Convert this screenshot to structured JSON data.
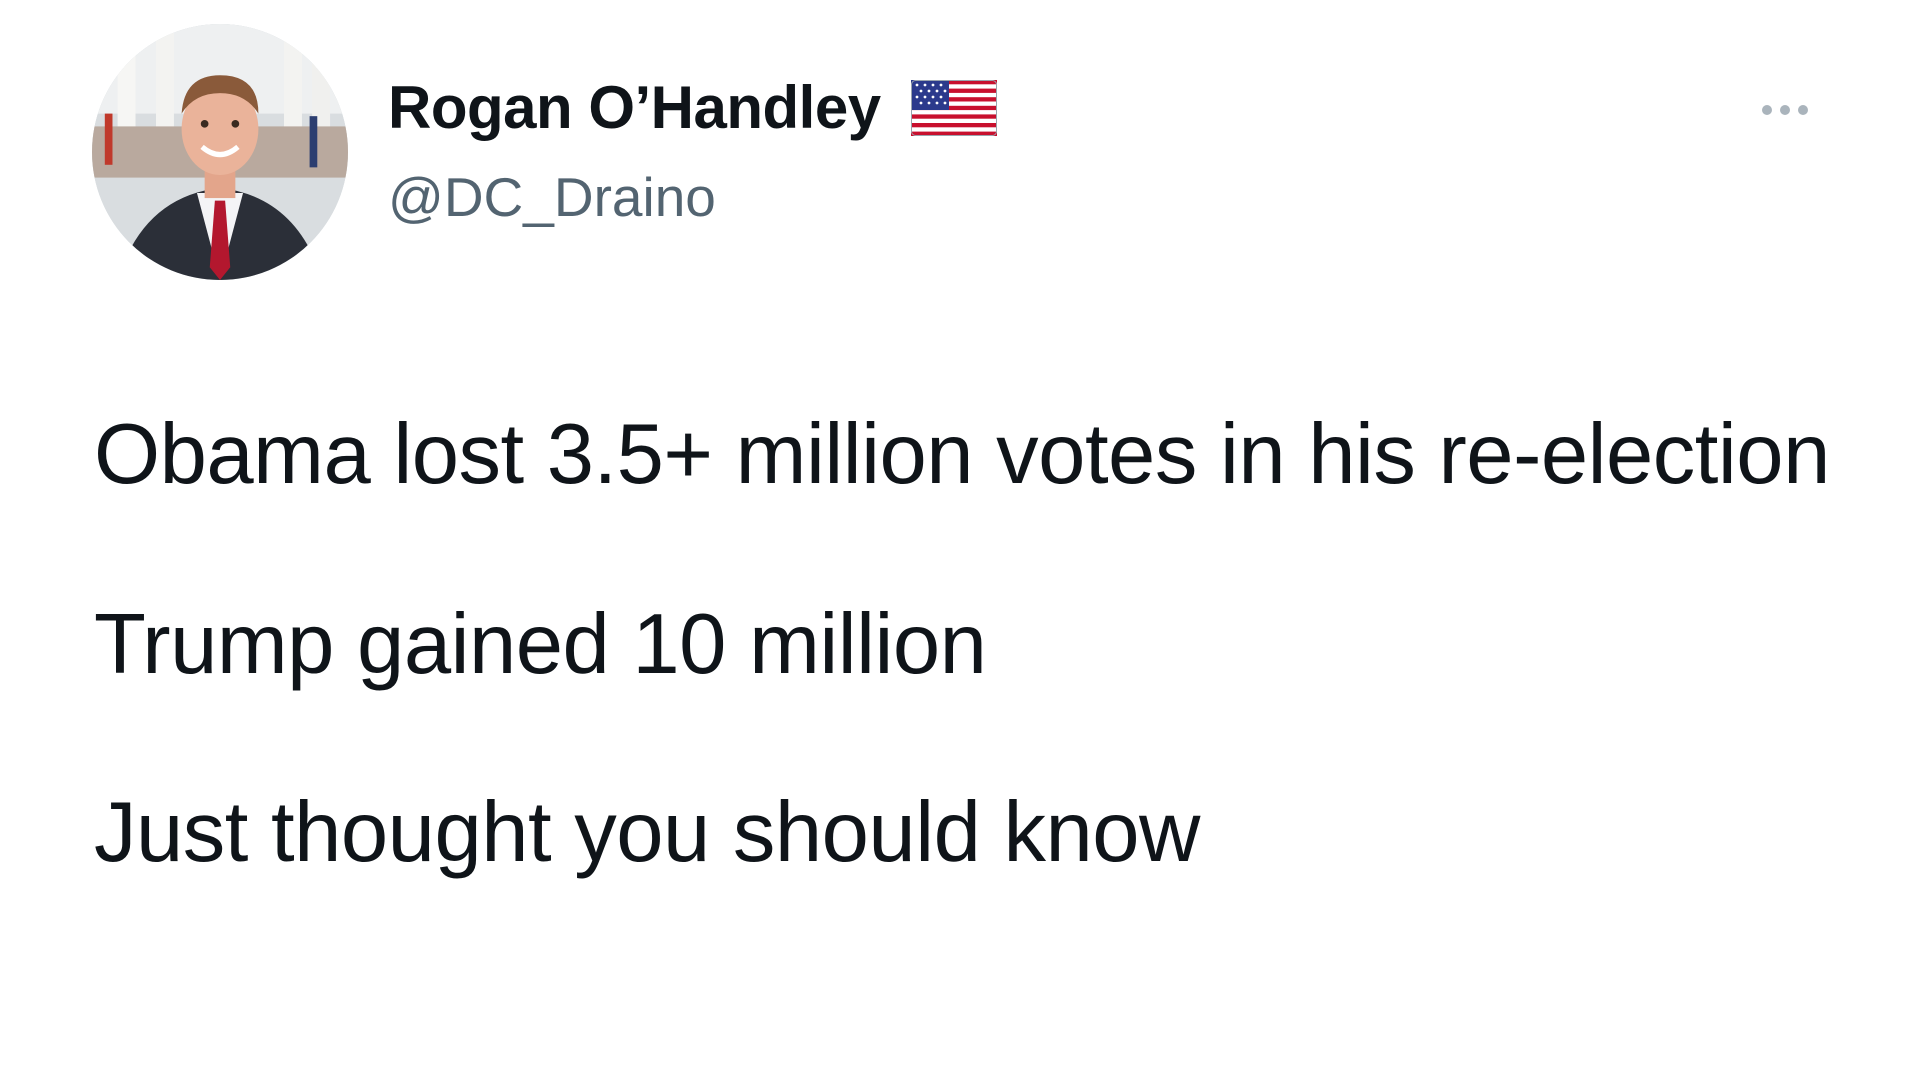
{
  "tweet": {
    "author": {
      "display_name": "Rogan O’Handley",
      "handle": "@DC_Draino",
      "avatar_icon": "profile-photo",
      "badge_icon": "us-flag-icon"
    },
    "more_icon": "more-dots-icon",
    "text_paragraphs": [
      "Obama lost 3.5+ million votes in his re-election",
      "Trump gained 10 million",
      "Just thought you should know"
    ]
  },
  "colors": {
    "text_primary": "#0f1419",
    "text_secondary": "#536471",
    "background": "#ffffff"
  }
}
